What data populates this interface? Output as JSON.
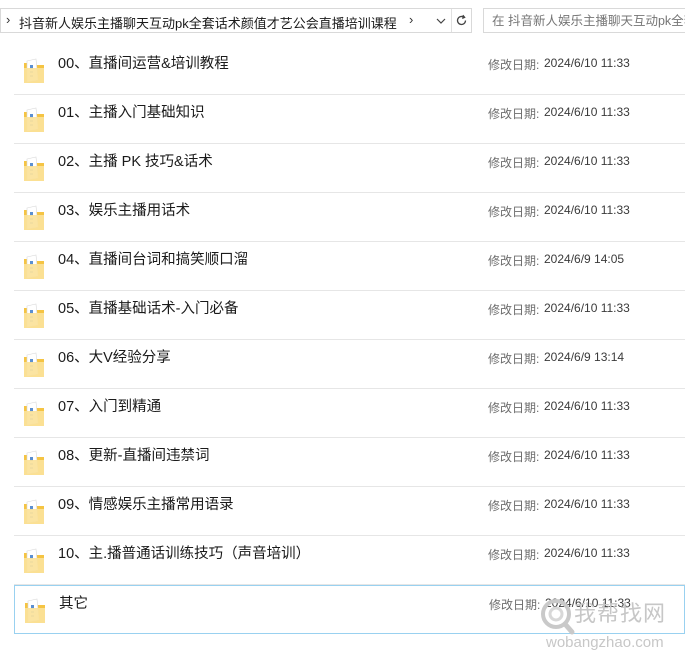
{
  "address_bar": {
    "path": "抖音新人娱乐主播聊天互动pk全套话术颜值才艺公会直播培训课程"
  },
  "search": {
    "placeholder": "在 抖音新人娱乐主播聊天互动pk全套话术颜值才艺公会直播培训课程 中搜索"
  },
  "files": [
    {
      "name": "00、直播间运营&培训教程",
      "date_label": "修改日期:",
      "date": "2024/6/10 11:33"
    },
    {
      "name": "01、主播入门基础知识",
      "date_label": "修改日期:",
      "date": "2024/6/10 11:33"
    },
    {
      "name": "02、主播 PK 技巧&话术",
      "date_label": "修改日期:",
      "date": "2024/6/10 11:33"
    },
    {
      "name": "03、娱乐主播用话术",
      "date_label": "修改日期:",
      "date": "2024/6/10 11:33"
    },
    {
      "name": "04、直播间台词和搞笑顺口溜",
      "date_label": "修改日期:",
      "date": "2024/6/9 14:05"
    },
    {
      "name": "05、直播基础话术-入门必备",
      "date_label": "修改日期:",
      "date": "2024/6/10 11:33"
    },
    {
      "name": "06、大V经验分享",
      "date_label": "修改日期:",
      "date": "2024/6/9 13:14"
    },
    {
      "name": "07、入门到精通",
      "date_label": "修改日期:",
      "date": "2024/6/10 11:33"
    },
    {
      "name": "08、更新-直播间违禁词",
      "date_label": "修改日期:",
      "date": "2024/6/10 11:33"
    },
    {
      "name": "09、情感娱乐主播常用语录",
      "date_label": "修改日期:",
      "date": "2024/6/10 11:33"
    },
    {
      "name": "10、主.播普通话训练技巧（声音培训）",
      "date_label": "修改日期:",
      "date": "2024/6/10 11:33"
    },
    {
      "name": "其它",
      "date_label": "修改日期:",
      "date": "2024/6/10 11:33"
    }
  ],
  "watermark": {
    "text": "我帮找网",
    "url": "wobangzhao.com"
  },
  "colors": {
    "folder_yellow": "#f5c443",
    "folder_light": "#fbe29a",
    "selection_border": "#99d1f0",
    "divider": "#e6e6e6"
  }
}
